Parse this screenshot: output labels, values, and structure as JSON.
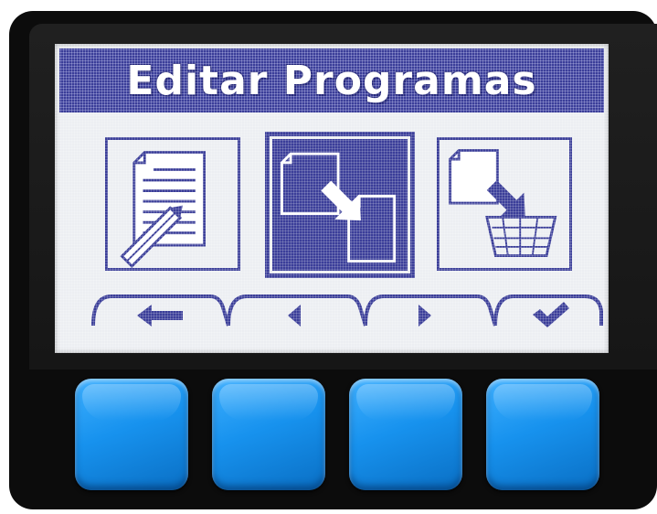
{
  "screen": {
    "title": "Editar Programas",
    "icons": [
      {
        "name": "edit-document-icon",
        "selected": false
      },
      {
        "name": "copy-program-icon",
        "selected": true
      },
      {
        "name": "delete-program-icon",
        "selected": false
      }
    ],
    "softkeys": [
      {
        "name": "back-arrow-icon"
      },
      {
        "name": "left-arrow-icon"
      },
      {
        "name": "right-arrow-icon"
      },
      {
        "name": "checkmark-icon"
      }
    ]
  },
  "hardware_buttons": [
    {
      "name": "softkey-button-1"
    },
    {
      "name": "softkey-button-2"
    },
    {
      "name": "softkey-button-3"
    },
    {
      "name": "softkey-button-4"
    }
  ],
  "colors": {
    "lcd_background": "#eceef2",
    "lcd_ink": "#3b3e99",
    "button_blue": "#1792ee",
    "device_body": "#0c0c0c"
  }
}
